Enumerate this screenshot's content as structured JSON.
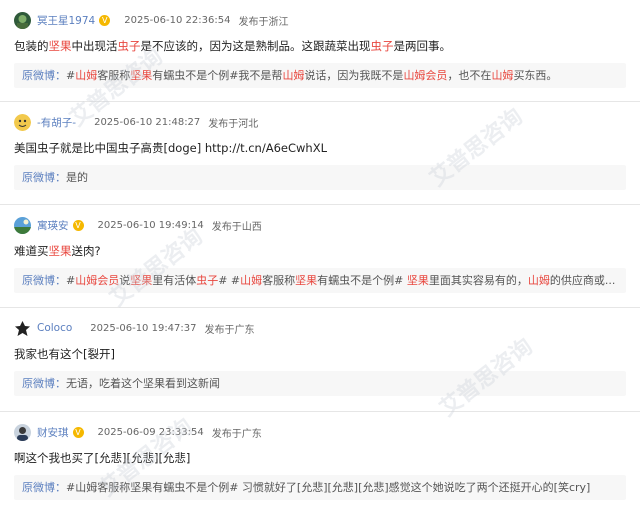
{
  "comments": [
    {
      "username": "冥王星1974",
      "verified": true,
      "timestamp": "2025-06-10 22:36:54",
      "location": "发布于浙江",
      "text_parts": [
        "包装的",
        "坚果",
        "中出现活",
        "虫子",
        "是不应该的，因为这是熟制品。这跟蔬菜出现",
        "虫子",
        "是两回事。"
      ],
      "quote_label": "原微博：",
      "quote_parts": [
        "#",
        "山姆",
        "客服称",
        "坚果",
        "有蠕虫不是个例#我不是帮",
        "山姆",
        "说话，因为我既不是",
        "山姆会员",
        "，也不在",
        "山姆",
        "买东西。"
      ]
    },
    {
      "username": "-有胡子-",
      "verified": false,
      "timestamp": "2025-06-10 21:48:27",
      "location": "发布于河北",
      "text_parts": [
        "美国虫子就是比中国虫子高贵[doge] http://t.cn/A6eCwhXL"
      ],
      "quote_label": "原微博：",
      "quote_parts": [
        "是的"
      ]
    },
    {
      "username": "寓瑛安",
      "verified": true,
      "timestamp": "2025-06-10 19:49:14",
      "location": "发布于山西",
      "text_parts": [
        "难道买",
        "坚果",
        "送肉?"
      ],
      "quote_label": "原微博：",
      "quote_parts": [
        "#",
        "山姆会员",
        "说",
        "坚果",
        "里有活体",
        "虫子",
        "# #",
        "山姆",
        "客服称",
        "坚果",
        "有蠕虫不是个例# ",
        "坚果",
        "里面其实容易有的，",
        "山姆",
        "的供应商或..."
      ]
    },
    {
      "username": "Coloco",
      "verified": false,
      "timestamp": "2025-06-10 19:47:37",
      "location": "发布于广东",
      "text_parts": [
        "我家也有这个[裂开]"
      ],
      "quote_label": "原微博：",
      "quote_parts": [
        "无语，吃着这个坚果看到这新闻"
      ]
    },
    {
      "username": "财安琪",
      "verified": true,
      "timestamp": "2025-06-09 23:33:54",
      "location": "发布于广东",
      "text_parts": [
        "啊这个我也买了[允悲][允悲][允悲]"
      ],
      "quote_label": "原微博：",
      "quote_parts": [
        "#山姆客服称坚果有蠕虫不是个例# 习惯就好了[允悲][允悲][允悲]感觉这个她说吃了两个还挺开心的[笑cry]"
      ]
    }
  ],
  "watermark_text": "艾普思咨询",
  "colors": {
    "username": "#5b7fbf",
    "highlight": "#e8473f",
    "quote_bg": "#f7f7f7",
    "verified_badge": "#f5b800"
  }
}
